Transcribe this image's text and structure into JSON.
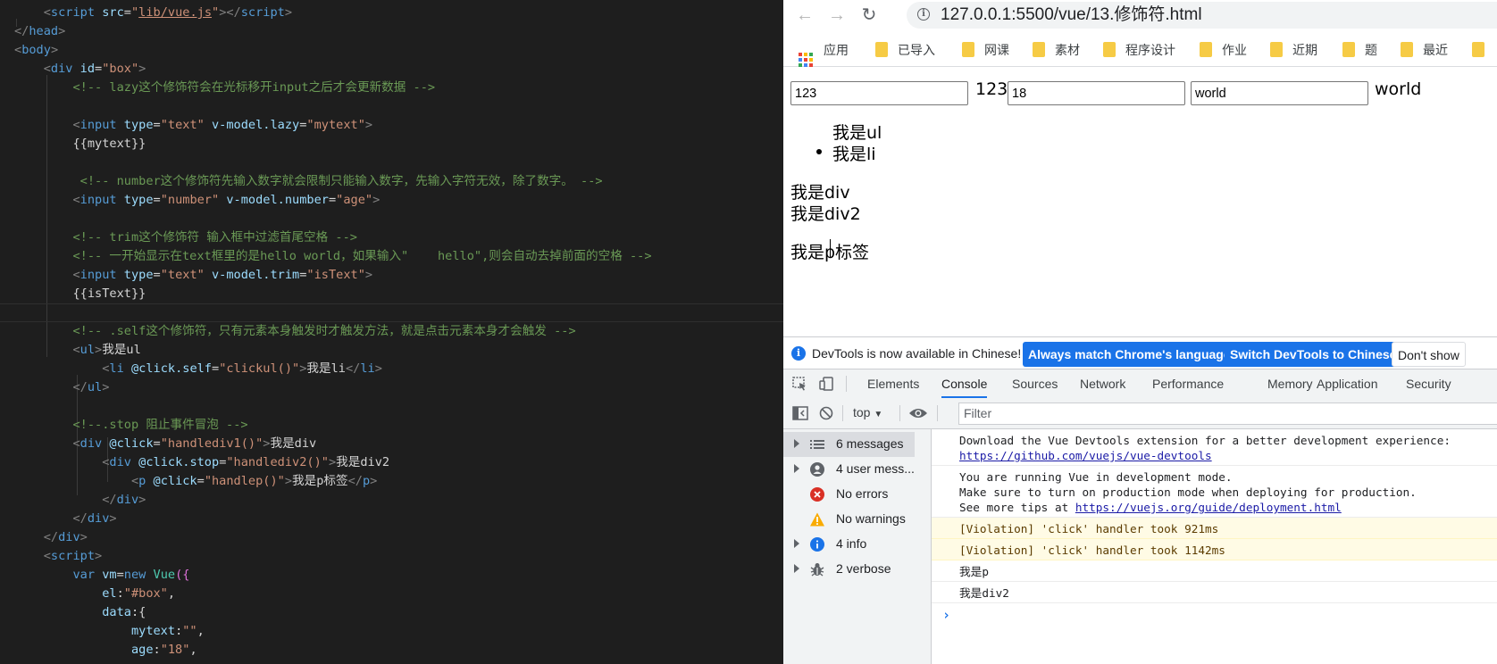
{
  "editor": {
    "lines": [
      [
        [
          "tk-br",
          "    <"
        ],
        [
          "tk-tag",
          "script"
        ],
        [
          "tk-attr",
          " src"
        ],
        [
          "tk-txt",
          "="
        ],
        [
          "tk-str",
          "\""
        ],
        [
          "tk-link",
          "lib/vue.js"
        ],
        [
          "tk-str",
          "\""
        ],
        [
          "tk-br",
          "></"
        ],
        [
          "tk-tag",
          "script"
        ],
        [
          "tk-br",
          ">"
        ]
      ],
      [
        [
          "tk-br",
          "</"
        ],
        [
          "tk-tag",
          "head"
        ],
        [
          "tk-br",
          ">"
        ]
      ],
      [
        [
          "tk-br",
          "<"
        ],
        [
          "tk-tag",
          "body"
        ],
        [
          "tk-br",
          ">"
        ]
      ],
      [
        [
          "tk-br",
          "    <"
        ],
        [
          "tk-tag",
          "div"
        ],
        [
          "tk-attr",
          " id"
        ],
        [
          "tk-txt",
          "="
        ],
        [
          "tk-str",
          "\"box\""
        ],
        [
          "tk-br",
          ">"
        ]
      ],
      [
        [
          "tk-com",
          "        <!-- lazy这个修饰符会在光标移开input之后才会更新数据 -->"
        ]
      ],
      [
        [
          "tk-txt",
          ""
        ]
      ],
      [
        [
          "tk-br",
          "        <"
        ],
        [
          "tk-tag",
          "input"
        ],
        [
          "tk-attr",
          " type"
        ],
        [
          "tk-txt",
          "="
        ],
        [
          "tk-str",
          "\"text\""
        ],
        [
          "tk-attr",
          " v-model.lazy"
        ],
        [
          "tk-txt",
          "="
        ],
        [
          "tk-str",
          "\"mytext\""
        ],
        [
          "tk-br",
          ">"
        ]
      ],
      [
        [
          "tk-txt",
          "        {{mytext}}"
        ]
      ],
      [
        [
          "tk-txt",
          ""
        ]
      ],
      [
        [
          "tk-com",
          "         <!-- number这个修饰符先输入数字就会限制只能输入数字，先输入字符无效，除了数字。 -->"
        ]
      ],
      [
        [
          "tk-br",
          "        <"
        ],
        [
          "tk-tag",
          "input"
        ],
        [
          "tk-attr",
          " type"
        ],
        [
          "tk-txt",
          "="
        ],
        [
          "tk-str",
          "\"number\""
        ],
        [
          "tk-attr",
          " v-model.number"
        ],
        [
          "tk-txt",
          "="
        ],
        [
          "tk-str",
          "\"age\""
        ],
        [
          "tk-br",
          ">"
        ]
      ],
      [
        [
          "tk-txt",
          ""
        ]
      ],
      [
        [
          "tk-com",
          "        <!-- trim这个修饰符 输入框中过滤首尾空格 -->"
        ]
      ],
      [
        [
          "tk-com",
          "        <!-- 一开始显示在text框里的是hello world，如果输入\"    hello\",则会自动去掉前面的空格 -->"
        ]
      ],
      [
        [
          "tk-br",
          "        <"
        ],
        [
          "tk-tag",
          "input"
        ],
        [
          "tk-attr",
          " type"
        ],
        [
          "tk-txt",
          "="
        ],
        [
          "tk-str",
          "\"text\""
        ],
        [
          "tk-attr",
          " v-model.trim"
        ],
        [
          "tk-txt",
          "="
        ],
        [
          "tk-str",
          "\"isText\""
        ],
        [
          "tk-br",
          ">"
        ]
      ],
      [
        [
          "tk-txt",
          "        {{isText}}"
        ]
      ],
      [
        [
          "tk-txt",
          ""
        ]
      ],
      [
        [
          "tk-com",
          "        <!-- .self这个修饰符，只有元素本身触发时才触发方法，就是点击元素本身才会触发 -->"
        ]
      ],
      [
        [
          "tk-br",
          "        <"
        ],
        [
          "tk-tag",
          "ul"
        ],
        [
          "tk-br",
          ">"
        ],
        [
          "tk-txt",
          "我是ul"
        ]
      ],
      [
        [
          "tk-br",
          "            <"
        ],
        [
          "tk-tag",
          "li"
        ],
        [
          "tk-attr",
          " @click.self"
        ],
        [
          "tk-txt",
          "="
        ],
        [
          "tk-str",
          "\"clickul()\""
        ],
        [
          "tk-br",
          ">"
        ],
        [
          "tk-txt",
          "我是li"
        ],
        [
          "tk-br",
          "</"
        ],
        [
          "tk-tag",
          "li"
        ],
        [
          "tk-br",
          ">"
        ]
      ],
      [
        [
          "tk-br",
          "        </"
        ],
        [
          "tk-tag",
          "ul"
        ],
        [
          "tk-br",
          ">"
        ]
      ],
      [
        [
          "tk-txt",
          ""
        ]
      ],
      [
        [
          "tk-com",
          "        <!--.stop 阻止事件冒泡 -->"
        ]
      ],
      [
        [
          "tk-br",
          "        <"
        ],
        [
          "tk-tag",
          "div"
        ],
        [
          "tk-attr",
          " @click"
        ],
        [
          "tk-txt",
          "="
        ],
        [
          "tk-str",
          "\"handlediv1()\""
        ],
        [
          "tk-br",
          ">"
        ],
        [
          "tk-txt",
          "我是div"
        ]
      ],
      [
        [
          "tk-br",
          "            <"
        ],
        [
          "tk-tag",
          "div"
        ],
        [
          "tk-attr",
          " @click.stop"
        ],
        [
          "tk-txt",
          "="
        ],
        [
          "tk-str",
          "\"handlediv2()\""
        ],
        [
          "tk-br",
          ">"
        ],
        [
          "tk-txt",
          "我是div2"
        ]
      ],
      [
        [
          "tk-br",
          "                <"
        ],
        [
          "tk-tag",
          "p"
        ],
        [
          "tk-attr",
          " @click"
        ],
        [
          "tk-txt",
          "="
        ],
        [
          "tk-str",
          "\"handlep()\""
        ],
        [
          "tk-br",
          ">"
        ],
        [
          "tk-txt",
          "我是p标签"
        ],
        [
          "tk-br",
          "</"
        ],
        [
          "tk-tag",
          "p"
        ],
        [
          "tk-br",
          ">"
        ]
      ],
      [
        [
          "tk-br",
          "            </"
        ],
        [
          "tk-tag",
          "div"
        ],
        [
          "tk-br",
          ">"
        ]
      ],
      [
        [
          "tk-br",
          "        </"
        ],
        [
          "tk-tag",
          "div"
        ],
        [
          "tk-br",
          ">"
        ]
      ],
      [
        [
          "tk-br",
          "    </"
        ],
        [
          "tk-tag",
          "div"
        ],
        [
          "tk-br",
          ">"
        ]
      ],
      [
        [
          "tk-br",
          "    <"
        ],
        [
          "tk-tag",
          "script"
        ],
        [
          "tk-br",
          ">"
        ]
      ],
      [
        [
          "tk-kw",
          "        var"
        ],
        [
          "tk-var",
          " vm"
        ],
        [
          "tk-txt",
          "="
        ],
        [
          "tk-kw",
          "new"
        ],
        [
          "tk-cls",
          " Vue"
        ],
        [
          "tk-brace",
          "({"
        ]
      ],
      [
        [
          "tk-var",
          "            el"
        ],
        [
          "tk-txt",
          ":"
        ],
        [
          "tk-str",
          "\"#box\""
        ],
        [
          "tk-txt",
          ","
        ]
      ],
      [
        [
          "tk-var",
          "            data"
        ],
        [
          "tk-txt",
          ":{"
        ]
      ],
      [
        [
          "tk-var",
          "                mytext"
        ],
        [
          "tk-txt",
          ":"
        ],
        [
          "tk-str",
          "\"\""
        ],
        [
          "tk-txt",
          ","
        ]
      ],
      [
        [
          "tk-var",
          "                age"
        ],
        [
          "tk-txt",
          ":"
        ],
        [
          "tk-str",
          "\"18\""
        ],
        [
          "tk-txt",
          ","
        ]
      ]
    ]
  },
  "browser": {
    "url": "127.0.0.1:5500/vue/13.修饰符.html",
    "bookmarks": [
      "应用",
      "已导入",
      "网课",
      "素材",
      "程序设计",
      "作业",
      "近期",
      "题",
      "最近"
    ],
    "page": {
      "input1_value": "123",
      "text1": "123",
      "input2_value": "18",
      "input3_value": "world",
      "text2": "world",
      "ul_text": "我是ul",
      "li_text": "我是li",
      "div_text": "我是div",
      "div2_text": "我是div2",
      "p_text": "我是p标签"
    }
  },
  "devtools": {
    "infobar": {
      "text": "DevTools is now available in Chinese!",
      "btn_match": "Always match Chrome's language",
      "btn_switch": "Switch DevTools to Chinese",
      "btn_dont": "Don't show"
    },
    "tabs": [
      "Elements",
      "Console",
      "Sources",
      "Network",
      "Performance",
      "Memory",
      "Application",
      "Security"
    ],
    "active_tab": "Console",
    "context": "top",
    "filter_placeholder": "Filter",
    "sidebar": [
      {
        "label": "6 messages",
        "icon": "list-icon",
        "selected": true
      },
      {
        "label": "4 user mess...",
        "icon": "user-icon",
        "selected": false
      },
      {
        "label": "No errors",
        "icon": "error-icon",
        "selected": false
      },
      {
        "label": "No warnings",
        "icon": "warning-icon",
        "selected": false
      },
      {
        "label": "4 info",
        "icon": "info-icon",
        "selected": false
      },
      {
        "label": "2 verbose",
        "icon": "bug-icon",
        "selected": false
      }
    ],
    "messages": [
      {
        "type": "log",
        "lines": [
          "Download the Vue Devtools extension for a better development experience:"
        ],
        "link": "https://github.com/vuejs/vue-devtools"
      },
      {
        "type": "log",
        "lines": [
          "You are running Vue in development mode.",
          "Make sure to turn on production mode when deploying for production."
        ],
        "prefix": "See more tips at ",
        "link": "https://vuejs.org/guide/deployment.html"
      },
      {
        "type": "warn",
        "lines": [
          "[Violation] 'click' handler took 921ms"
        ]
      },
      {
        "type": "warn",
        "lines": [
          "[Violation] 'click' handler took 1142ms"
        ]
      },
      {
        "type": "log",
        "lines": [
          "我是p"
        ]
      },
      {
        "type": "log",
        "lines": [
          "我是div2"
        ]
      }
    ],
    "prompt": "›"
  }
}
